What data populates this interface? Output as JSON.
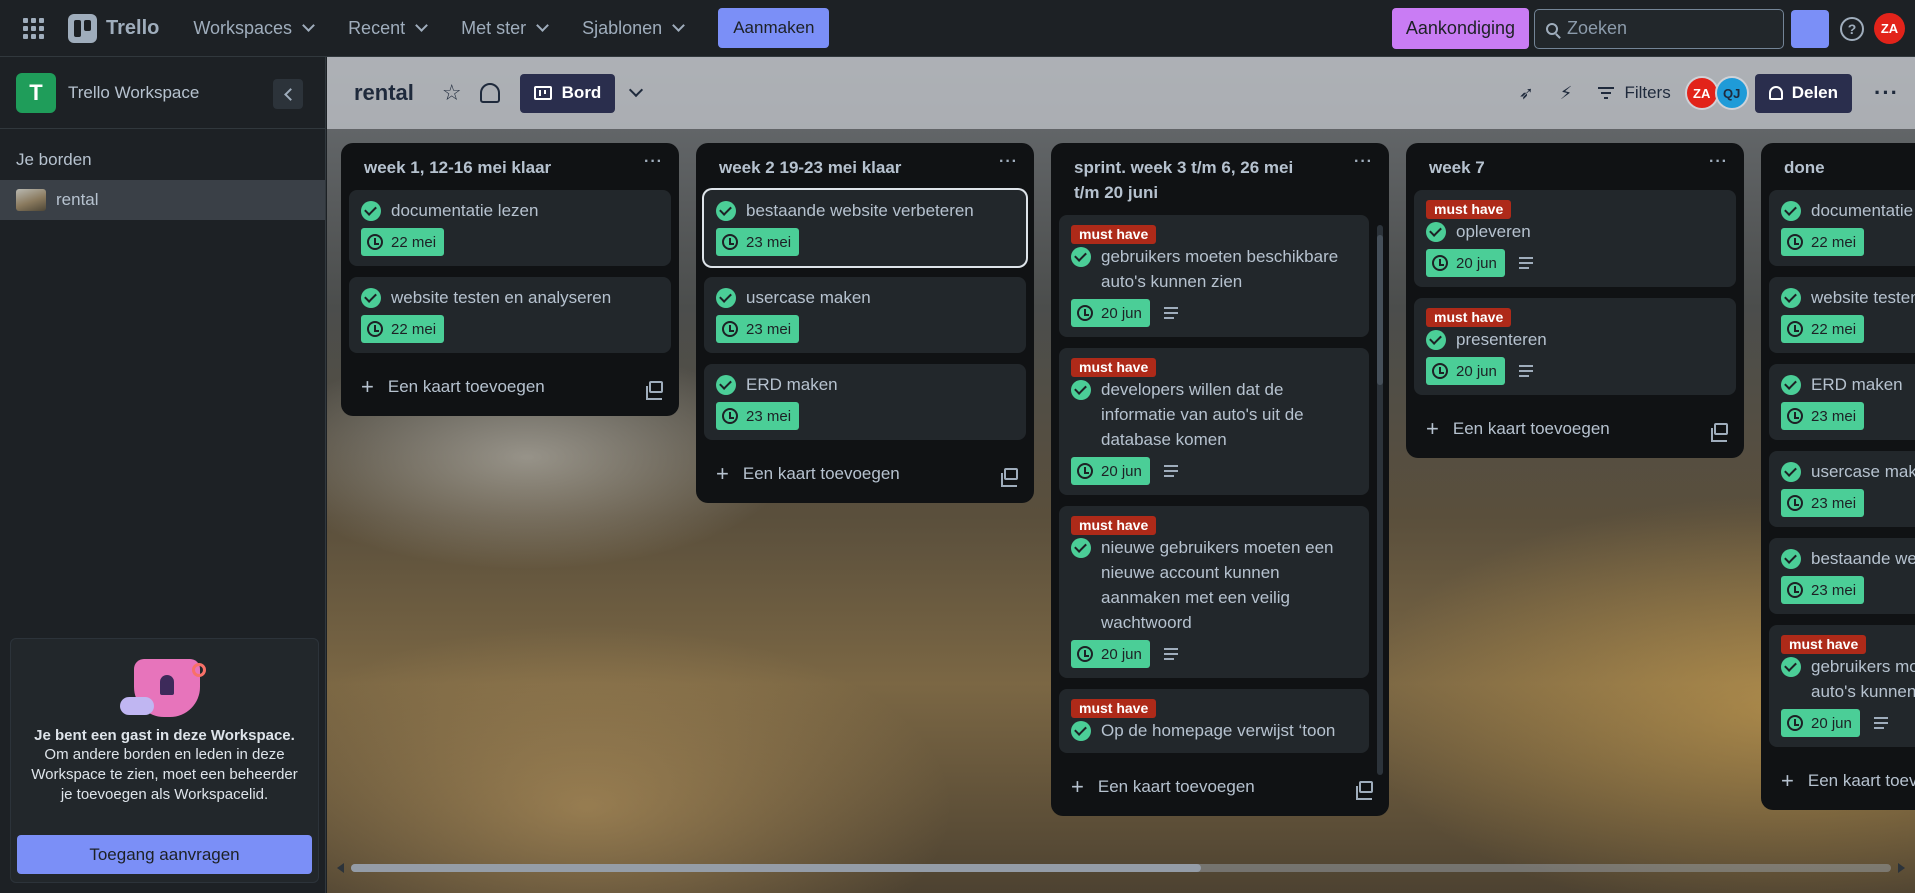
{
  "topnav": {
    "app_name": "Trello",
    "menus": [
      {
        "label": "Workspaces"
      },
      {
        "label": "Recent"
      },
      {
        "label": "Met ster"
      },
      {
        "label": "Sjablonen"
      }
    ],
    "create_label": "Aanmaken",
    "announce_label": "Aankondiging",
    "search_placeholder": "Zoeken",
    "help_glyph": "?",
    "avatar_initials": "ZA"
  },
  "sidebar": {
    "workspace_initial": "T",
    "workspace_name": "Trello Workspace",
    "boards_heading": "Je borden",
    "boards": [
      {
        "label": "rental"
      }
    ],
    "guest": {
      "title": "Je bent een gast in deze Workspace.",
      "text": "Om andere borden en leden in deze Workspace te zien, moet een beheerder je toevoegen als Workspacelid.",
      "button": "Toegang aanvragen"
    }
  },
  "board": {
    "title": "rental",
    "view_label": "Bord",
    "filters_label": "Filters",
    "members": [
      {
        "initials": "ZA",
        "color": "#e2231a"
      },
      {
        "initials": "QJ",
        "color": "#1f9bd8"
      }
    ],
    "share_label": "Delen",
    "add_card_label": "Een kaart toevoegen",
    "lists": [
      {
        "title": "week 1, 12-16 mei klaar",
        "cards": [
          {
            "title": "documentatie lezen",
            "due": "22 mei"
          },
          {
            "title": "website testen en analyseren",
            "due": "22 mei"
          }
        ]
      },
      {
        "title": "week 2 19-23 mei klaar",
        "cards": [
          {
            "title": "bestaande website verbeteren",
            "due": "23 mei",
            "selected": true
          },
          {
            "title": "usercase maken",
            "due": "23 mei"
          },
          {
            "title": "ERD maken",
            "due": "23 mei"
          }
        ]
      },
      {
        "title": "sprint. week 3 t/m 6, 26 mei t/m 20 juni",
        "cards": [
          {
            "label": "must have",
            "title": "gebruikers moeten beschikbare auto's kunnen zien",
            "due": "20 jun",
            "desc": true
          },
          {
            "label": "must have",
            "title": "developers willen dat de informatie van auto's uit de database komen",
            "due": "20 jun",
            "desc": true
          },
          {
            "label": "must have",
            "title": "nieuwe gebruikers moeten een nieuwe account kunnen aanmaken met een veilig wachtwoord",
            "due": "20 jun",
            "desc": true
          },
          {
            "label": "must have",
            "title": "Op de homepage verwijst ‘toon"
          }
        ]
      },
      {
        "title": "week 7",
        "cards": [
          {
            "label": "must have",
            "title": "opleveren",
            "due": "20 jun",
            "desc": true
          },
          {
            "label": "must have",
            "title": "presenteren",
            "due": "20 jun",
            "desc": true
          }
        ]
      },
      {
        "title": "done",
        "cards": [
          {
            "title": "documentatie lezen",
            "due": "22 mei"
          },
          {
            "title": "website testen en analyseren",
            "due": "22 mei"
          },
          {
            "title": "ERD maken",
            "due": "23 mei"
          },
          {
            "title": "usercase maken",
            "due": "23 mei"
          },
          {
            "title": "bestaande website verbeteren",
            "due": "23 mei"
          },
          {
            "label": "must have",
            "title": "gebruikers moeten beschikbare auto's kunnen zien",
            "due": "20 jun",
            "desc": true
          }
        ]
      }
    ]
  }
}
